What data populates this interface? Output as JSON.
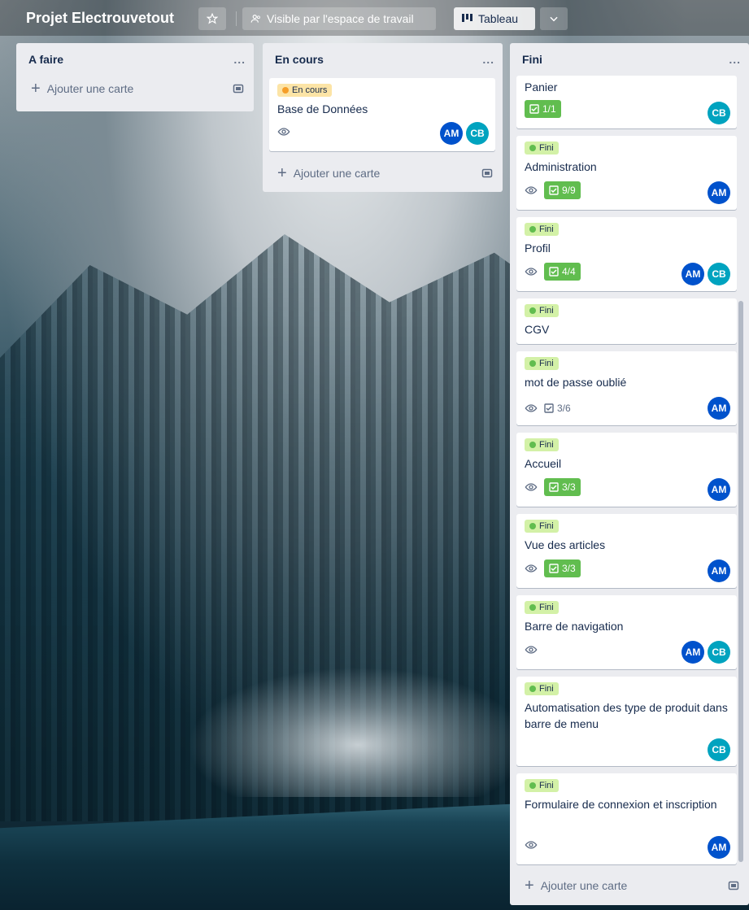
{
  "header": {
    "title": "Projet Electrouvetout",
    "star_icon": "star-icon",
    "visibility_label": "Visible par l'espace de travail",
    "view_label": "Tableau"
  },
  "lists": [
    {
      "title": "A faire",
      "menu": "...",
      "add_label": "Ajouter une carte"
    },
    {
      "title": "En cours",
      "menu": "...",
      "add_label": "Ajouter une carte"
    },
    {
      "title": "Fini",
      "menu": "...",
      "add_label": "Ajouter une carte"
    }
  ],
  "cards": {
    "en_cours": [
      {
        "label": "En cours",
        "title": "Base de Données",
        "members": [
          "AM",
          "CB"
        ]
      }
    ],
    "fini": [
      {
        "label": "",
        "title": "Panier",
        "checklist": "1/1",
        "members": [
          "CB"
        ]
      },
      {
        "label": "Fini",
        "title": "Administration",
        "checklist": "9/9",
        "members": [
          "AM"
        ]
      },
      {
        "label": "Fini",
        "title": "Profil",
        "checklist": "4/4",
        "members": [
          "AM",
          "CB"
        ]
      },
      {
        "label": "Fini",
        "title": "CGV"
      },
      {
        "label": "Fini",
        "title": "mot de passe oublié",
        "checklist": "3/6",
        "members": [
          "AM"
        ]
      },
      {
        "label": "Fini",
        "title": "Accueil",
        "checklist": "3/3",
        "members": [
          "AM"
        ]
      },
      {
        "label": "Fini",
        "title": "Vue des articles",
        "checklist": "3/3",
        "members": [
          "AM"
        ]
      },
      {
        "label": "Fini",
        "title": "Barre de navigation",
        "members": [
          "AM",
          "CB"
        ]
      },
      {
        "label": "Fini",
        "title": "Automatisation des type de produit dans barre de menu",
        "members": [
          "CB"
        ]
      },
      {
        "label": "Fini",
        "title": "Formulaire de connexion et inscription",
        "members": [
          "AM"
        ]
      }
    ]
  },
  "colors": {
    "label_fini": "#d3f1a7",
    "label_en_cours": "#fce4a6",
    "checklist_done": "#61bd4f",
    "avatar_am": "#0052cc",
    "avatar_cb": "#00a3bf"
  }
}
